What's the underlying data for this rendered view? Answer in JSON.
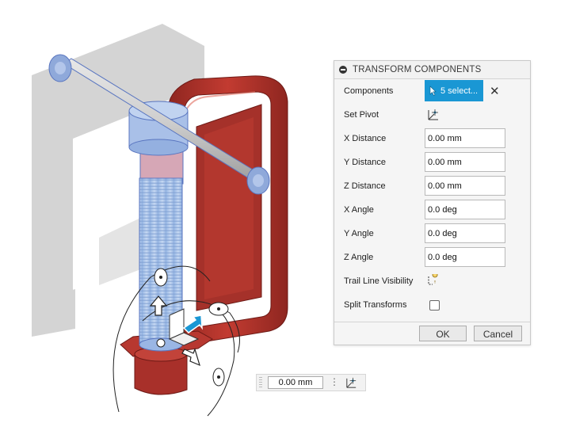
{
  "panel": {
    "title": "TRANSFORM COMPONENTS",
    "components": {
      "label": "Components",
      "button": "5 select..."
    },
    "set_pivot": {
      "label": "Set Pivot"
    },
    "x_distance": {
      "label": "X Distance",
      "value": "0.00 mm"
    },
    "y_distance": {
      "label": "Y Distance",
      "value": "0.00 mm"
    },
    "z_distance": {
      "label": "Z Distance",
      "value": "0.00 mm"
    },
    "x_angle": {
      "label": "X Angle",
      "value": "0.0 deg"
    },
    "y_angle": {
      "label": "Y Angle",
      "value": "0.0 deg"
    },
    "z_angle": {
      "label": "Z Angle",
      "value": "0.0 deg"
    },
    "trail_line": {
      "label": "Trail Line Visibility"
    },
    "split_transforms": {
      "label": "Split Transforms",
      "checked": false
    },
    "ok": "OK",
    "cancel": "Cancel"
  },
  "mini_toolbar": {
    "value": "0.00 mm"
  },
  "colors": {
    "accent": "#1a97d4",
    "clamp_frame": "#b8352c",
    "selection": "#8fb2e0",
    "shadow": "#d0d0d0"
  },
  "icons": {
    "collapse": "minus-circle-icon",
    "select": "cursor-arrow-icon",
    "clear": "close-icon",
    "pivot": "pivot-axes-icon",
    "trail": "trail-line-icon",
    "more": "vertical-dots-icon"
  }
}
